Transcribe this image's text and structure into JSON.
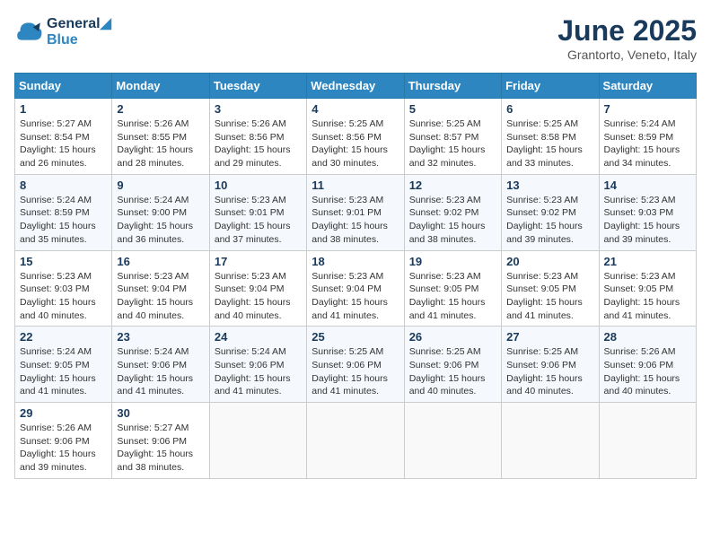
{
  "header": {
    "logo_line1": "General",
    "logo_line2": "Blue",
    "month": "June 2025",
    "location": "Grantorto, Veneto, Italy"
  },
  "weekdays": [
    "Sunday",
    "Monday",
    "Tuesday",
    "Wednesday",
    "Thursday",
    "Friday",
    "Saturday"
  ],
  "weeks": [
    [
      {
        "day": "1",
        "sunrise": "Sunrise: 5:27 AM",
        "sunset": "Sunset: 8:54 PM",
        "daylight": "Daylight: 15 hours and 26 minutes."
      },
      {
        "day": "2",
        "sunrise": "Sunrise: 5:26 AM",
        "sunset": "Sunset: 8:55 PM",
        "daylight": "Daylight: 15 hours and 28 minutes."
      },
      {
        "day": "3",
        "sunrise": "Sunrise: 5:26 AM",
        "sunset": "Sunset: 8:56 PM",
        "daylight": "Daylight: 15 hours and 29 minutes."
      },
      {
        "day": "4",
        "sunrise": "Sunrise: 5:25 AM",
        "sunset": "Sunset: 8:56 PM",
        "daylight": "Daylight: 15 hours and 30 minutes."
      },
      {
        "day": "5",
        "sunrise": "Sunrise: 5:25 AM",
        "sunset": "Sunset: 8:57 PM",
        "daylight": "Daylight: 15 hours and 32 minutes."
      },
      {
        "day": "6",
        "sunrise": "Sunrise: 5:25 AM",
        "sunset": "Sunset: 8:58 PM",
        "daylight": "Daylight: 15 hours and 33 minutes."
      },
      {
        "day": "7",
        "sunrise": "Sunrise: 5:24 AM",
        "sunset": "Sunset: 8:59 PM",
        "daylight": "Daylight: 15 hours and 34 minutes."
      }
    ],
    [
      {
        "day": "8",
        "sunrise": "Sunrise: 5:24 AM",
        "sunset": "Sunset: 8:59 PM",
        "daylight": "Daylight: 15 hours and 35 minutes."
      },
      {
        "day": "9",
        "sunrise": "Sunrise: 5:24 AM",
        "sunset": "Sunset: 9:00 PM",
        "daylight": "Daylight: 15 hours and 36 minutes."
      },
      {
        "day": "10",
        "sunrise": "Sunrise: 5:23 AM",
        "sunset": "Sunset: 9:01 PM",
        "daylight": "Daylight: 15 hours and 37 minutes."
      },
      {
        "day": "11",
        "sunrise": "Sunrise: 5:23 AM",
        "sunset": "Sunset: 9:01 PM",
        "daylight": "Daylight: 15 hours and 38 minutes."
      },
      {
        "day": "12",
        "sunrise": "Sunrise: 5:23 AM",
        "sunset": "Sunset: 9:02 PM",
        "daylight": "Daylight: 15 hours and 38 minutes."
      },
      {
        "day": "13",
        "sunrise": "Sunrise: 5:23 AM",
        "sunset": "Sunset: 9:02 PM",
        "daylight": "Daylight: 15 hours and 39 minutes."
      },
      {
        "day": "14",
        "sunrise": "Sunrise: 5:23 AM",
        "sunset": "Sunset: 9:03 PM",
        "daylight": "Daylight: 15 hours and 39 minutes."
      }
    ],
    [
      {
        "day": "15",
        "sunrise": "Sunrise: 5:23 AM",
        "sunset": "Sunset: 9:03 PM",
        "daylight": "Daylight: 15 hours and 40 minutes."
      },
      {
        "day": "16",
        "sunrise": "Sunrise: 5:23 AM",
        "sunset": "Sunset: 9:04 PM",
        "daylight": "Daylight: 15 hours and 40 minutes."
      },
      {
        "day": "17",
        "sunrise": "Sunrise: 5:23 AM",
        "sunset": "Sunset: 9:04 PM",
        "daylight": "Daylight: 15 hours and 40 minutes."
      },
      {
        "day": "18",
        "sunrise": "Sunrise: 5:23 AM",
        "sunset": "Sunset: 9:04 PM",
        "daylight": "Daylight: 15 hours and 41 minutes."
      },
      {
        "day": "19",
        "sunrise": "Sunrise: 5:23 AM",
        "sunset": "Sunset: 9:05 PM",
        "daylight": "Daylight: 15 hours and 41 minutes."
      },
      {
        "day": "20",
        "sunrise": "Sunrise: 5:23 AM",
        "sunset": "Sunset: 9:05 PM",
        "daylight": "Daylight: 15 hours and 41 minutes."
      },
      {
        "day": "21",
        "sunrise": "Sunrise: 5:23 AM",
        "sunset": "Sunset: 9:05 PM",
        "daylight": "Daylight: 15 hours and 41 minutes."
      }
    ],
    [
      {
        "day": "22",
        "sunrise": "Sunrise: 5:24 AM",
        "sunset": "Sunset: 9:05 PM",
        "daylight": "Daylight: 15 hours and 41 minutes."
      },
      {
        "day": "23",
        "sunrise": "Sunrise: 5:24 AM",
        "sunset": "Sunset: 9:06 PM",
        "daylight": "Daylight: 15 hours and 41 minutes."
      },
      {
        "day": "24",
        "sunrise": "Sunrise: 5:24 AM",
        "sunset": "Sunset: 9:06 PM",
        "daylight": "Daylight: 15 hours and 41 minutes."
      },
      {
        "day": "25",
        "sunrise": "Sunrise: 5:25 AM",
        "sunset": "Sunset: 9:06 PM",
        "daylight": "Daylight: 15 hours and 41 minutes."
      },
      {
        "day": "26",
        "sunrise": "Sunrise: 5:25 AM",
        "sunset": "Sunset: 9:06 PM",
        "daylight": "Daylight: 15 hours and 40 minutes."
      },
      {
        "day": "27",
        "sunrise": "Sunrise: 5:25 AM",
        "sunset": "Sunset: 9:06 PM",
        "daylight": "Daylight: 15 hours and 40 minutes."
      },
      {
        "day": "28",
        "sunrise": "Sunrise: 5:26 AM",
        "sunset": "Sunset: 9:06 PM",
        "daylight": "Daylight: 15 hours and 40 minutes."
      }
    ],
    [
      {
        "day": "29",
        "sunrise": "Sunrise: 5:26 AM",
        "sunset": "Sunset: 9:06 PM",
        "daylight": "Daylight: 15 hours and 39 minutes."
      },
      {
        "day": "30",
        "sunrise": "Sunrise: 5:27 AM",
        "sunset": "Sunset: 9:06 PM",
        "daylight": "Daylight: 15 hours and 38 minutes."
      },
      null,
      null,
      null,
      null,
      null
    ]
  ]
}
